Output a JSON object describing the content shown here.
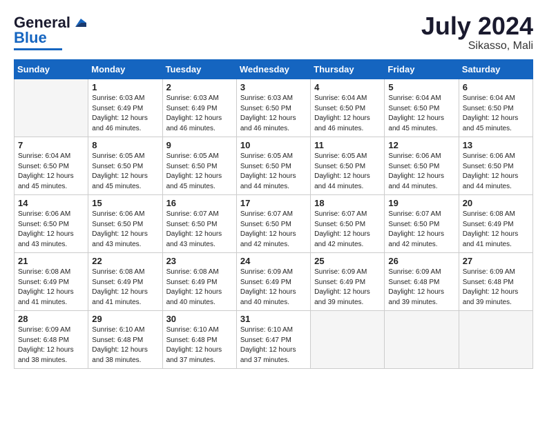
{
  "header": {
    "logo_general": "General",
    "logo_blue": "Blue",
    "month_year": "July 2024",
    "location": "Sikasso, Mali"
  },
  "columns": [
    "Sunday",
    "Monday",
    "Tuesday",
    "Wednesday",
    "Thursday",
    "Friday",
    "Saturday"
  ],
  "weeks": [
    [
      {
        "day": "",
        "empty": true
      },
      {
        "day": "1",
        "sunrise": "6:03 AM",
        "sunset": "6:49 PM",
        "daylight": "12 hours and 46 minutes."
      },
      {
        "day": "2",
        "sunrise": "6:03 AM",
        "sunset": "6:49 PM",
        "daylight": "12 hours and 46 minutes."
      },
      {
        "day": "3",
        "sunrise": "6:03 AM",
        "sunset": "6:50 PM",
        "daylight": "12 hours and 46 minutes."
      },
      {
        "day": "4",
        "sunrise": "6:04 AM",
        "sunset": "6:50 PM",
        "daylight": "12 hours and 46 minutes."
      },
      {
        "day": "5",
        "sunrise": "6:04 AM",
        "sunset": "6:50 PM",
        "daylight": "12 hours and 45 minutes."
      },
      {
        "day": "6",
        "sunrise": "6:04 AM",
        "sunset": "6:50 PM",
        "daylight": "12 hours and 45 minutes."
      }
    ],
    [
      {
        "day": "7",
        "sunrise": "6:04 AM",
        "sunset": "6:50 PM",
        "daylight": "12 hours and 45 minutes."
      },
      {
        "day": "8",
        "sunrise": "6:05 AM",
        "sunset": "6:50 PM",
        "daylight": "12 hours and 45 minutes."
      },
      {
        "day": "9",
        "sunrise": "6:05 AM",
        "sunset": "6:50 PM",
        "daylight": "12 hours and 45 minutes."
      },
      {
        "day": "10",
        "sunrise": "6:05 AM",
        "sunset": "6:50 PM",
        "daylight": "12 hours and 44 minutes."
      },
      {
        "day": "11",
        "sunrise": "6:05 AM",
        "sunset": "6:50 PM",
        "daylight": "12 hours and 44 minutes."
      },
      {
        "day": "12",
        "sunrise": "6:06 AM",
        "sunset": "6:50 PM",
        "daylight": "12 hours and 44 minutes."
      },
      {
        "day": "13",
        "sunrise": "6:06 AM",
        "sunset": "6:50 PM",
        "daylight": "12 hours and 44 minutes."
      }
    ],
    [
      {
        "day": "14",
        "sunrise": "6:06 AM",
        "sunset": "6:50 PM",
        "daylight": "12 hours and 43 minutes."
      },
      {
        "day": "15",
        "sunrise": "6:06 AM",
        "sunset": "6:50 PM",
        "daylight": "12 hours and 43 minutes."
      },
      {
        "day": "16",
        "sunrise": "6:07 AM",
        "sunset": "6:50 PM",
        "daylight": "12 hours and 43 minutes."
      },
      {
        "day": "17",
        "sunrise": "6:07 AM",
        "sunset": "6:50 PM",
        "daylight": "12 hours and 42 minutes."
      },
      {
        "day": "18",
        "sunrise": "6:07 AM",
        "sunset": "6:50 PM",
        "daylight": "12 hours and 42 minutes."
      },
      {
        "day": "19",
        "sunrise": "6:07 AM",
        "sunset": "6:50 PM",
        "daylight": "12 hours and 42 minutes."
      },
      {
        "day": "20",
        "sunrise": "6:08 AM",
        "sunset": "6:49 PM",
        "daylight": "12 hours and 41 minutes."
      }
    ],
    [
      {
        "day": "21",
        "sunrise": "6:08 AM",
        "sunset": "6:49 PM",
        "daylight": "12 hours and 41 minutes."
      },
      {
        "day": "22",
        "sunrise": "6:08 AM",
        "sunset": "6:49 PM",
        "daylight": "12 hours and 41 minutes."
      },
      {
        "day": "23",
        "sunrise": "6:08 AM",
        "sunset": "6:49 PM",
        "daylight": "12 hours and 40 minutes."
      },
      {
        "day": "24",
        "sunrise": "6:09 AM",
        "sunset": "6:49 PM",
        "daylight": "12 hours and 40 minutes."
      },
      {
        "day": "25",
        "sunrise": "6:09 AM",
        "sunset": "6:49 PM",
        "daylight": "12 hours and 39 minutes."
      },
      {
        "day": "26",
        "sunrise": "6:09 AM",
        "sunset": "6:48 PM",
        "daylight": "12 hours and 39 minutes."
      },
      {
        "day": "27",
        "sunrise": "6:09 AM",
        "sunset": "6:48 PM",
        "daylight": "12 hours and 39 minutes."
      }
    ],
    [
      {
        "day": "28",
        "sunrise": "6:09 AM",
        "sunset": "6:48 PM",
        "daylight": "12 hours and 38 minutes."
      },
      {
        "day": "29",
        "sunrise": "6:10 AM",
        "sunset": "6:48 PM",
        "daylight": "12 hours and 38 minutes."
      },
      {
        "day": "30",
        "sunrise": "6:10 AM",
        "sunset": "6:48 PM",
        "daylight": "12 hours and 37 minutes."
      },
      {
        "day": "31",
        "sunrise": "6:10 AM",
        "sunset": "6:47 PM",
        "daylight": "12 hours and 37 minutes."
      },
      {
        "day": "",
        "empty": true
      },
      {
        "day": "",
        "empty": true
      },
      {
        "day": "",
        "empty": true
      }
    ]
  ]
}
